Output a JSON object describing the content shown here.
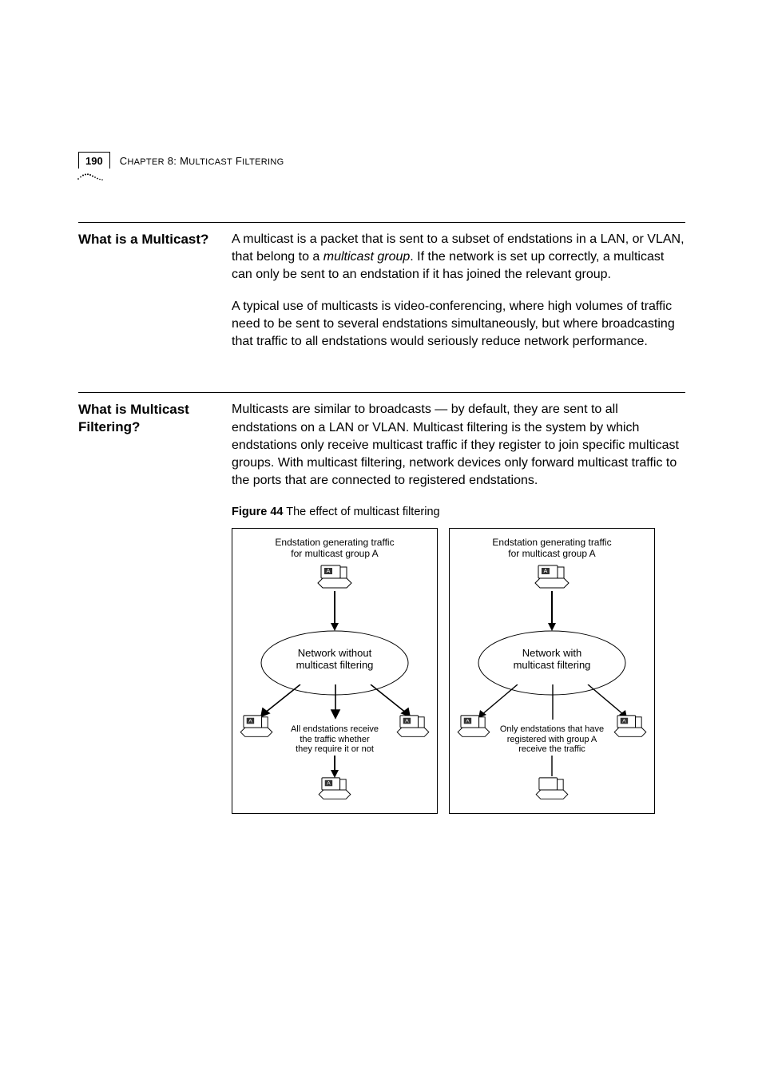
{
  "header": {
    "pageNumber": "190",
    "chapterLabel": "Chapter 8: Multicast Filtering"
  },
  "sections": [
    {
      "heading": "What is a Multicast?",
      "paragraphs": [
        "A multicast is a packet that is sent to a subset of endstations in a LAN, or VLAN, that belong to a <i>multicast group</i>. If the network is set up correctly, a multicast can only be sent to an endstation if it has joined the relevant group.",
        "A typical use of multicasts is video-conferencing, where high volumes of traffic need to be sent to several endstations simultaneously, but where broadcasting that traffic to all endstations would seriously reduce network performance."
      ]
    },
    {
      "heading": "What is Multicast Filtering?",
      "paragraphs": [
        "Multicasts are similar to broadcasts — by default, they are sent to all endstations on a LAN or VLAN. Multicast filtering is the system by which endstations only receive multicast traffic if they register to join specific multicast groups. With multicast filtering, network devices only forward multicast traffic to the ports that are connected to registered endstations."
      ],
      "figure": {
        "captionBold": "Figure 44",
        "captionRest": "   The effect of multicast filtering",
        "panels": [
          {
            "topText": "Endstation generating traffic\nfor multicast group A",
            "networkLabel": "Network without\nmulticast filtering",
            "bottomLabel": "All endstations receive\nthe traffic whether\nthey require it or not",
            "labelA": "A",
            "variant": "without"
          },
          {
            "topText": "Endstation generating traffic\nfor multicast group A",
            "networkLabel": "Network with\nmulticast filtering",
            "bottomLabel": "Only endstations that have\nregistered with group A\nreceive the traffic",
            "labelA": "A",
            "variant": "with"
          }
        ]
      }
    }
  ]
}
